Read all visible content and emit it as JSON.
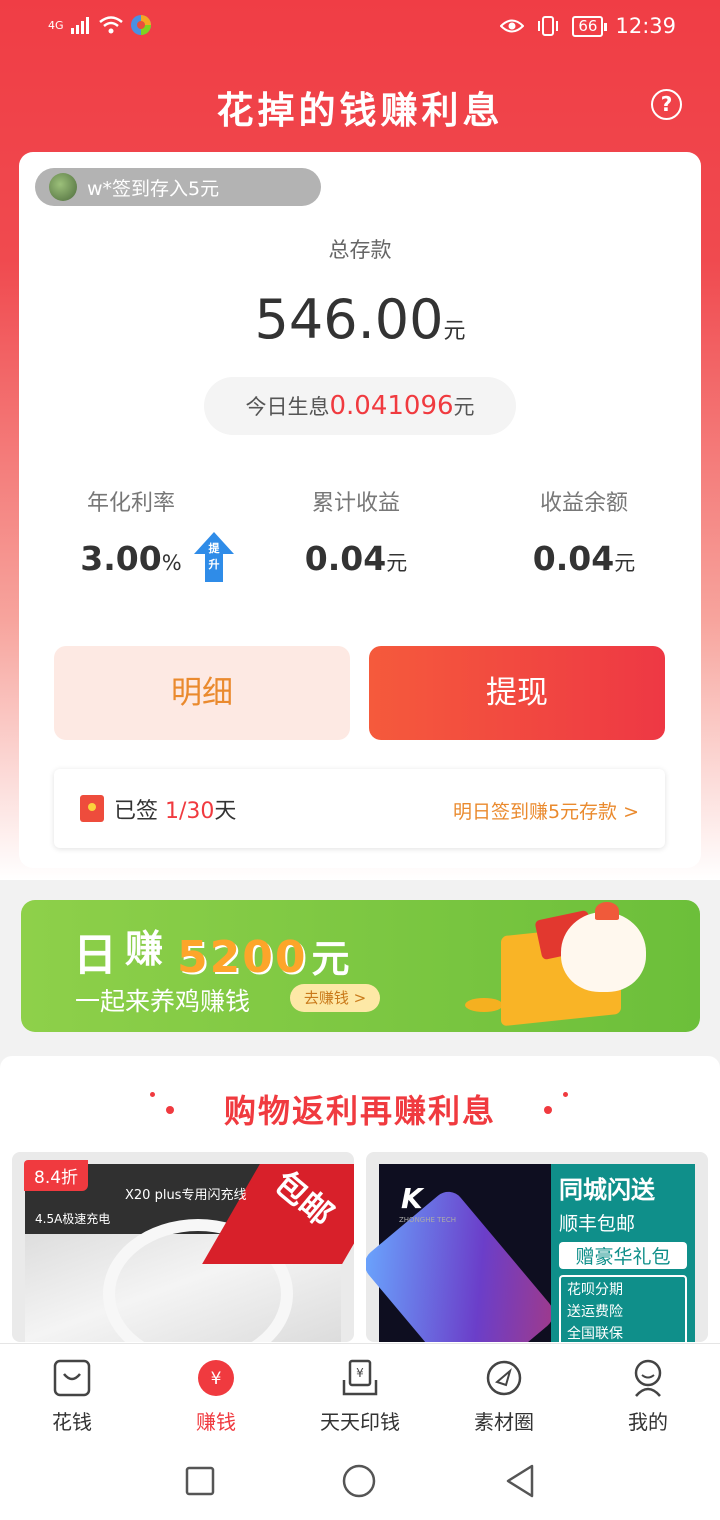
{
  "status_bar": {
    "network": "4G",
    "battery": "66",
    "time": "12:39"
  },
  "header": {
    "title": "花掉的钱赚利息"
  },
  "ticker": {
    "text": "w*签到存入5元"
  },
  "deposit": {
    "label": "总存款",
    "amount": "546.00",
    "unit": "元",
    "interest_label": "今日生息",
    "interest_value": "0.041096",
    "interest_unit": "元"
  },
  "stats": [
    {
      "label": "年化利率",
      "value": "3.00",
      "unit": "%"
    },
    {
      "label": "累计收益",
      "value": "0.04",
      "unit": "元"
    },
    {
      "label": "收益余额",
      "value": "0.04",
      "unit": "元"
    }
  ],
  "boost_badge": "提升",
  "buttons": {
    "detail": "明细",
    "withdraw": "提现"
  },
  "signin": {
    "prefix": "已签 ",
    "count": "1/30",
    "suffix": "天",
    "link": "明日签到赚5元存款 >"
  },
  "banner": {
    "ri": "日",
    "zhuan": "赚",
    "amount": "5200",
    "yuan": "元",
    "subtitle": "一起来养鸡赚钱",
    "button": "去赚钱 >"
  },
  "shopping": {
    "title": "购物返利再赚利息",
    "products": [
      {
        "discount": "8.4折",
        "caption": "X20 plus专用闪充线",
        "sub_caption": "4.5A极速充电",
        "ribbon": "包邮"
      },
      {
        "logo": "K",
        "logo_sub": "ZHONGHE TECH",
        "line1": "同城闪送",
        "line2": "顺丰包邮",
        "line3": "赠豪华礼包",
        "features": [
          "花呗分期",
          "送运费险",
          "全国联保"
        ]
      }
    ]
  },
  "tabbar": [
    {
      "label": "花钱",
      "icon": "bag-icon",
      "active": false
    },
    {
      "label": "赚钱",
      "icon": "yen-coin-icon",
      "active": true
    },
    {
      "label": "天天印钱",
      "icon": "printer-icon",
      "active": false
    },
    {
      "label": "素材圈",
      "icon": "compass-icon",
      "active": false
    },
    {
      "label": "我的",
      "icon": "user-icon",
      "active": false
    }
  ],
  "colors": {
    "primary_red": "#f03a3f",
    "orange": "#ea8a2e",
    "banner_green": "#7ac843"
  }
}
